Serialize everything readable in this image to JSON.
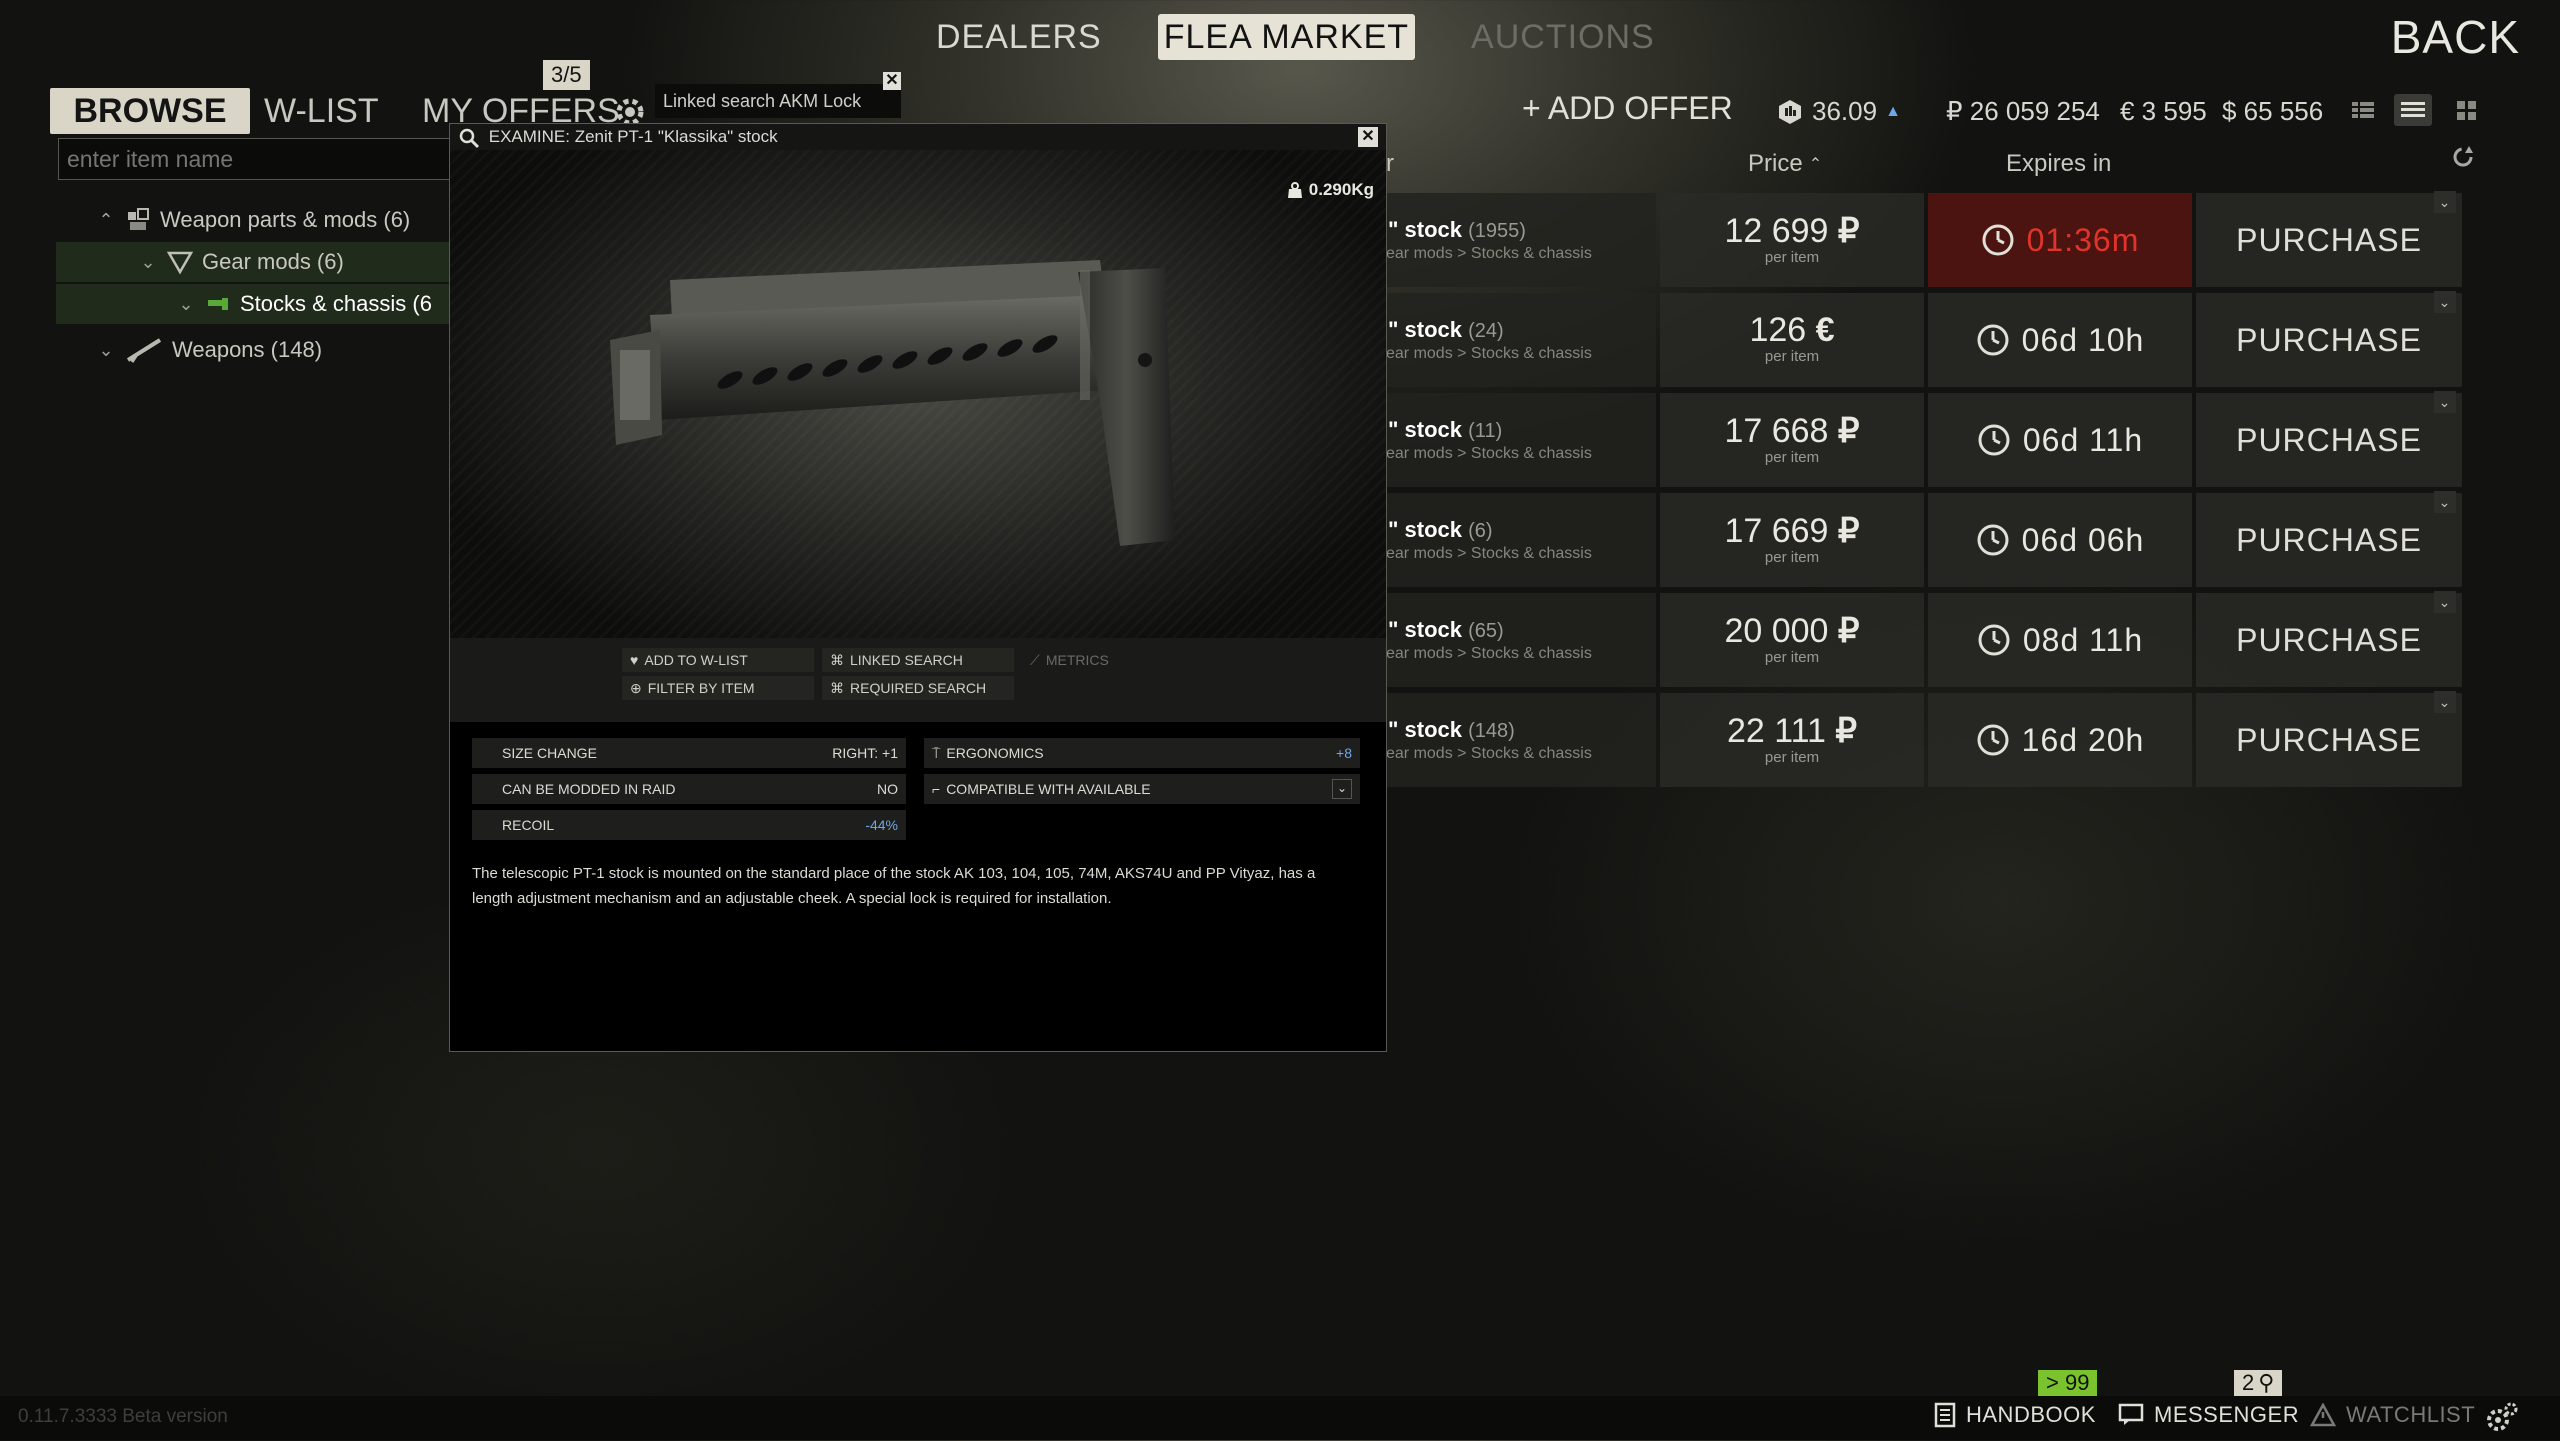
{
  "topnav": {
    "dealers": "DEALERS",
    "flea_market": "FLEA MARKET",
    "auctions": "AUCTIONS",
    "back": "BACK"
  },
  "subtabs": {
    "browse": "BROWSE",
    "wlist": "W-LIST",
    "my_offers": "MY OFFERS",
    "offers_count": "3/5"
  },
  "linked_search": "Linked search AKM Lock",
  "search": {
    "placeholder": "enter item name"
  },
  "tree": [
    {
      "label": "Weapon parts & mods (6)"
    },
    {
      "label": "Gear mods (6)"
    },
    {
      "label": "Stocks & chassis (6"
    },
    {
      "label": "Weapons (148)"
    }
  ],
  "header": {
    "add_offer": "+ ADD OFFER",
    "rating": "36.09",
    "roubles": "₽ 26 059 254",
    "euros": "€ 3 595",
    "dollars": "$ 65 556",
    "col_seller": "r",
    "col_price": "Price",
    "col_expires": "Expires in"
  },
  "offers": [
    {
      "name": "\" stock",
      "count": "(1955)",
      "category": "ear mods > Stocks & chassis",
      "price": "12 699",
      "currency": "₽",
      "per": "per item",
      "expires": "01:36m",
      "buy": "PURCHASE",
      "urgent": true
    },
    {
      "name": "\" stock",
      "count": "(24)",
      "category": "ear mods > Stocks & chassis",
      "price": "126",
      "currency": "€",
      "per": "per item",
      "expires": "06d 10h",
      "buy": "PURCHASE",
      "urgent": false
    },
    {
      "name": "\" stock",
      "count": "(11)",
      "category": "ear mods > Stocks & chassis",
      "price": "17 668",
      "currency": "₽",
      "per": "per item",
      "expires": "06d 11h",
      "buy": "PURCHASE",
      "urgent": false
    },
    {
      "name": "\" stock",
      "count": "(6)",
      "category": "ear mods > Stocks & chassis",
      "price": "17 669",
      "currency": "₽",
      "per": "per item",
      "expires": "06d 06h",
      "buy": "PURCHASE",
      "urgent": false
    },
    {
      "name": "\" stock",
      "count": "(65)",
      "category": "ear mods > Stocks & chassis",
      "price": "20 000",
      "currency": "₽",
      "per": "per item",
      "expires": "08d 11h",
      "buy": "PURCHASE",
      "urgent": false
    },
    {
      "name": "\" stock",
      "count": "(148)",
      "category": "ear mods > Stocks & chassis",
      "price": "22 111",
      "currency": "₽",
      "per": "per item",
      "expires": "16d 20h",
      "buy": "PURCHASE",
      "urgent": false
    }
  ],
  "examine": {
    "title": "EXAMINE: Zenit PT-1 \"Klassika\" stock",
    "weight": "0.290Kg",
    "actions": {
      "add_wlist": "ADD TO W-LIST",
      "linked_search": "LINKED SEARCH",
      "metrics": "METRICS",
      "filter_by_item": "FILTER BY ITEM",
      "required_search": "REQUIRED SEARCH"
    },
    "stats": {
      "size_change_label": "SIZE CHANGE",
      "size_change_value": "RIGHT: +1",
      "moddable_label": "CAN BE MODDED IN RAID",
      "moddable_value": "NO",
      "recoil_label": "RECOIL",
      "recoil_value": "-44%",
      "ergonomics_label": "ERGONOMICS",
      "ergonomics_value": "+8",
      "compatible_label": "COMPATIBLE WITH AVAILABLE"
    },
    "description": "The telescopic PT-1 stock is mounted on the standard place of the stock AK 103, 104, 105, 74M, AKS74U and PP Vityaz, has a length adjustment mechanism and an adjustable cheek. A special lock is required for installation."
  },
  "bottom": {
    "version": "0.11.7.3333 Beta version",
    "handbook": "HANDBOOK",
    "messenger": "MESSENGER",
    "watchlist": "WATCHLIST",
    "messenger_badge": "> 99",
    "watch_badge": "2"
  },
  "colors": {
    "accent_red": "#e0342a",
    "urgent_bg": "#4b1410",
    "badge_green": "#7bc22f",
    "stat_blue": "#6ea6e8"
  }
}
